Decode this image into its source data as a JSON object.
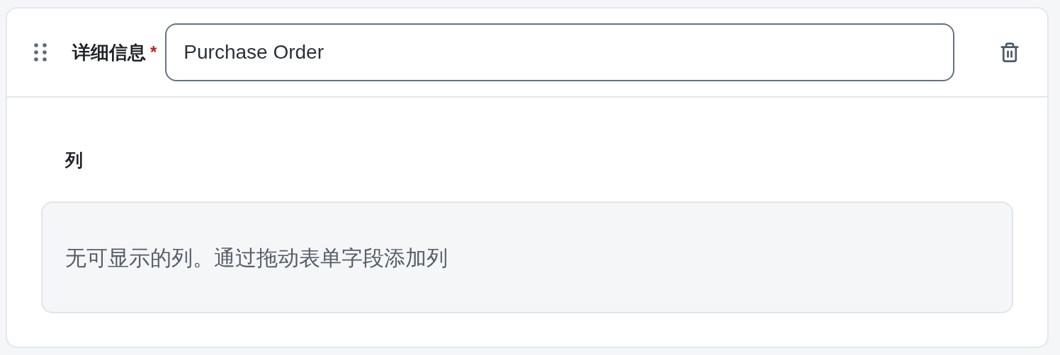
{
  "field": {
    "label": "详细信息",
    "required": true,
    "required_mark": "*",
    "value": "Purchase Order"
  },
  "columns": {
    "heading": "列",
    "empty_message": "无可显示的列。通过拖动表单字段添加列"
  }
}
